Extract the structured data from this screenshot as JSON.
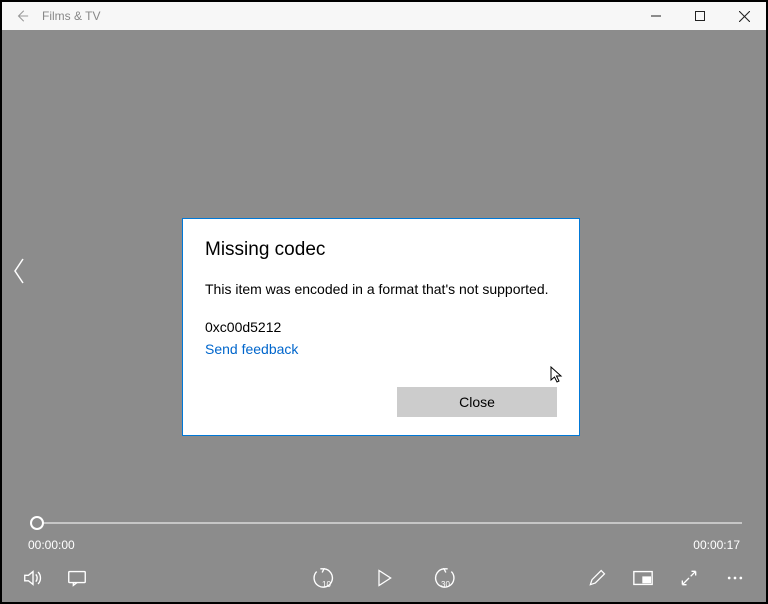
{
  "titlebar": {
    "app_title": "Films & TV"
  },
  "dialog": {
    "heading": "Missing codec",
    "message": "This item was encoded in a format that's not supported.",
    "error_code": "0xc00d5212",
    "feedback_link": "Send feedback",
    "close_label": "Close"
  },
  "player": {
    "current_time": "00:00:00",
    "total_time": "00:00:17",
    "skip_back_seconds": "10",
    "skip_forward_seconds": "30"
  }
}
